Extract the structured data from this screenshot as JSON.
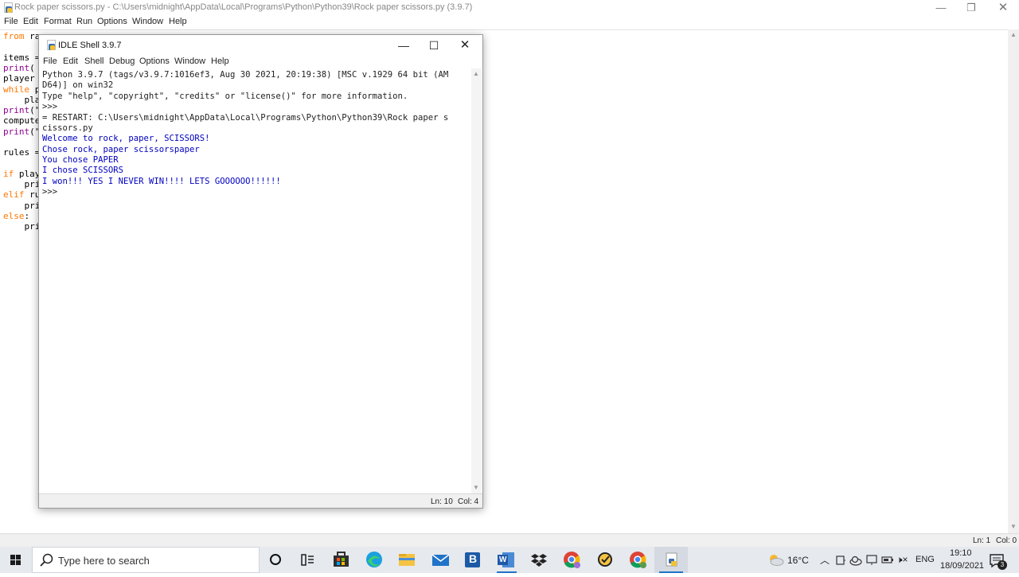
{
  "editor": {
    "title": "Rock paper scissors.py - C:\\Users\\midnight\\AppData\\Local\\Programs\\Python\\Python39\\Rock paper scissors.py (3.9.7)",
    "menu": [
      "File",
      "Edit",
      "Format",
      "Run",
      "Options",
      "Window",
      "Help"
    ],
    "code_fragments": {
      "l1a": "from",
      "l1b": " ra",
      "l3": "items =",
      "l4a": "print",
      "l4b": "(",
      "l5": "player",
      "l6a": "while",
      "l6b": " p",
      "l7": "    pla",
      "l8a": "print",
      "l8b": "(\"",
      "l9": "compute",
      "l10a": "print",
      "l10b": "(\"",
      "l12": "rules =",
      "l14a": "if",
      "l14b": " play",
      "l15": "    pri",
      "l16a": "elif",
      "l16b": " ru",
      "l17": "    pri",
      "l18a": "else",
      "l18b": ":",
      "l19": "    pri"
    },
    "status": {
      "ln": "Ln: 1",
      "col": "Col: 0"
    }
  },
  "shell": {
    "title": "IDLE Shell 3.9.7",
    "menu": [
      "File",
      "Edit",
      "Shell",
      "Debug",
      "Options",
      "Window",
      "Help"
    ],
    "lines": [
      {
        "text": "Python 3.9.7 (tags/v3.9.7:1016ef3, Aug 30 2021, 20:19:38) [MSC v.1929 64 bit (AM",
        "cls": "prompt"
      },
      {
        "text": "D64)] on win32",
        "cls": "prompt"
      },
      {
        "text": "Type \"help\", \"copyright\", \"credits\" or \"license()\" for more information.",
        "cls": "prompt"
      },
      {
        "text": ">>>",
        "cls": "prompt"
      },
      {
        "text": "= RESTART: C:\\Users\\midnight\\AppData\\Local\\Programs\\Python\\Python39\\Rock paper s",
        "cls": "prompt"
      },
      {
        "text": "cissors.py",
        "cls": "prompt"
      },
      {
        "text": "Welcome to rock, paper, SCISSORS!",
        "cls": "out"
      },
      {
        "text": "Chose rock, paper scissorspaper",
        "cls": "out"
      },
      {
        "text": "You chose PAPER",
        "cls": "out"
      },
      {
        "text": "I chose SCISSORS",
        "cls": "out"
      },
      {
        "text": "I won!!! YES I NEVER WIN!!!! LETS GOOOOOO!!!!!!",
        "cls": "out"
      },
      {
        "text": ">>>",
        "cls": "prompt"
      }
    ],
    "status": {
      "ln": "Ln: 10",
      "col": "Col: 4"
    }
  },
  "taskbar": {
    "search_placeholder": "Type here to search",
    "weather": "16°C",
    "lang": "ENG",
    "time": "19:10",
    "date": "18/09/2021",
    "notification_count": "3",
    "app_letters": {
      "bookings": "B",
      "word": "W"
    }
  }
}
